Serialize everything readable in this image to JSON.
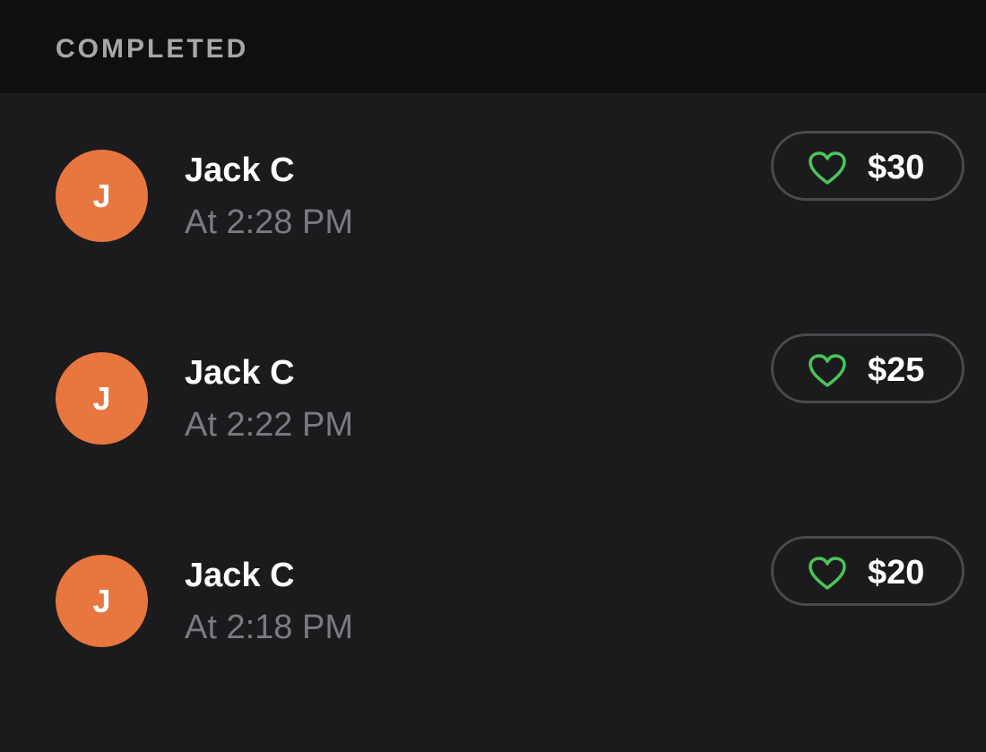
{
  "section": {
    "title": "COMPLETED"
  },
  "colors": {
    "background": "#1b1b1d",
    "header_background": "#0f0f10",
    "avatar": "#e8763f",
    "heart": "#4cc35a",
    "pill_border": "#4a4a4d",
    "secondary_text": "#7b7b7f"
  },
  "items": [
    {
      "initial": "J",
      "name": "Jack C",
      "time": "At 2:28 PM",
      "amount": "$30",
      "icon": "heart-icon"
    },
    {
      "initial": "J",
      "name": "Jack C",
      "time": "At 2:22 PM",
      "amount": "$25",
      "icon": "heart-icon"
    },
    {
      "initial": "J",
      "name": "Jack C",
      "time": "At 2:18 PM",
      "amount": "$20",
      "icon": "heart-icon"
    }
  ]
}
